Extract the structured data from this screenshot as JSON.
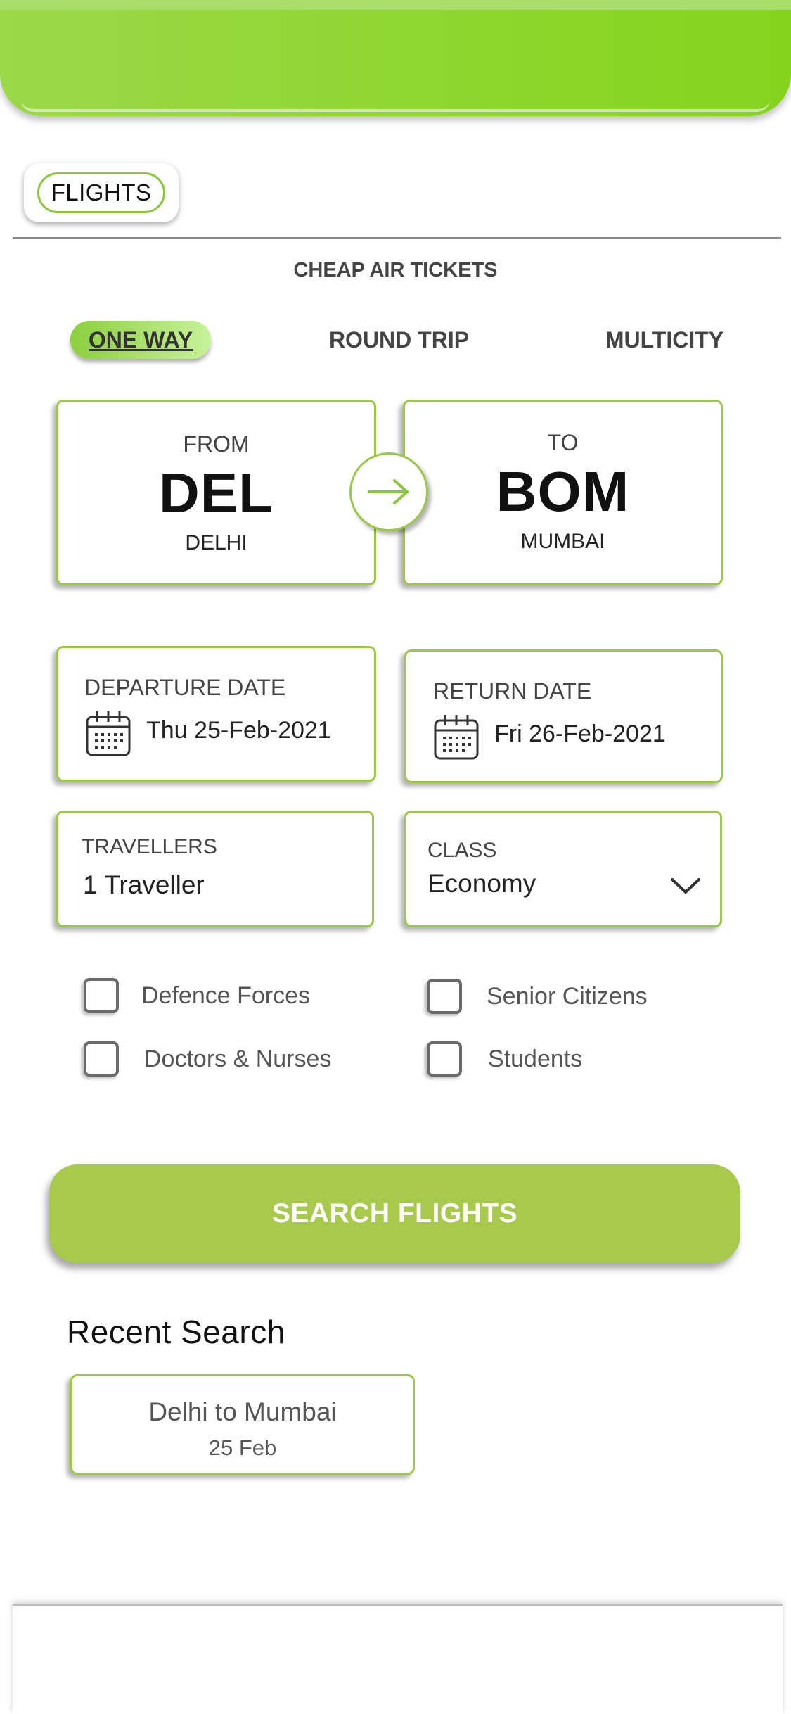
{
  "header": {
    "accent_color": "#8fd62f"
  },
  "mode_chip": {
    "label": "FLIGHTS"
  },
  "subtitle": "CHEAP AIR TICKETS",
  "trip_types": [
    {
      "label": "ONE WAY",
      "active": true
    },
    {
      "label": "ROUND TRIP",
      "active": false
    },
    {
      "label": "MULTICITY",
      "active": false
    }
  ],
  "from": {
    "label": "FROM",
    "code": "DEL",
    "city": "DELHI"
  },
  "to": {
    "label": "TO",
    "code": "BOM",
    "city": "MUMBAI"
  },
  "swap_icon": "arrow-right-icon",
  "departure": {
    "label": "DEPARTURE DATE",
    "value": "Thu 25-Feb-2021",
    "icon": "calendar-icon"
  },
  "return": {
    "label": "RETURN DATE",
    "value": "Fri 26-Feb-2021",
    "icon": "calendar-icon"
  },
  "travellers": {
    "label": "TRAVELLERS",
    "value": "1 Traveller"
  },
  "travel_class": {
    "label": "CLASS",
    "value": "Economy",
    "icon": "chevron-down-icon"
  },
  "fare_options": [
    {
      "label": "Defence Forces",
      "checked": false
    },
    {
      "label": "Senior Citizens",
      "checked": false
    },
    {
      "label": "Doctors & Nurses",
      "checked": false
    },
    {
      "label": "Students",
      "checked": false
    }
  ],
  "search_button": {
    "label": "SEARCH FLIGHTS",
    "color": "#a8ca4c"
  },
  "recent": {
    "title": "Recent Search",
    "items": [
      {
        "route": "Delhi to Mumbai",
        "date": "25 Feb"
      }
    ]
  },
  "colors": {
    "card_border": "#9cc84a",
    "header": "#8fd62f"
  }
}
